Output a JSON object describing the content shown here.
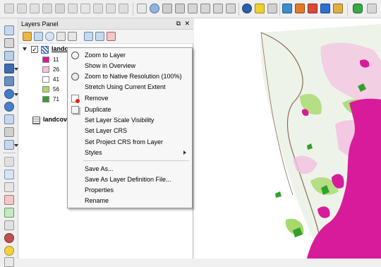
{
  "layers_panel": {
    "title": "Layers Panel",
    "float_glyph": "⧉",
    "close_glyph": "✕",
    "layers": [
      {
        "name": "landc",
        "checked": true,
        "expanded": true,
        "legend": [
          {
            "value": "11",
            "color": "#d81b9b"
          },
          {
            "value": "26",
            "color": "#f3bfe0"
          },
          {
            "value": "41",
            "color": "#ffffff"
          },
          {
            "value": "56",
            "color": "#a6d96a"
          },
          {
            "value": "71",
            "color": "#33a02c"
          }
        ]
      },
      {
        "name": "landcove",
        "checked": false,
        "expanded": false
      }
    ]
  },
  "context_menu": {
    "items": [
      {
        "label": "Zoom to Layer",
        "icon": "zoom-to-layer-icon"
      },
      {
        "label": "Show in Overview",
        "icon": ""
      },
      {
        "label": "Zoom to Native Resolution (100%)",
        "icon": "zoom-native-icon"
      },
      {
        "label": "Stretch Using Current Extent",
        "icon": ""
      },
      {
        "label": "Remove",
        "icon": "remove-layer-icon"
      },
      {
        "label": "Duplicate",
        "icon": "duplicate-layer-icon"
      },
      {
        "label": "Set Layer Scale Visibility",
        "icon": ""
      },
      {
        "label": "Set Layer CRS",
        "icon": ""
      },
      {
        "label": "Set Project CRS from Layer",
        "icon": ""
      },
      {
        "label": "Styles",
        "icon": "",
        "submenu": true
      },
      {
        "label": "Save As...",
        "icon": ""
      },
      {
        "label": "Save As Layer Definition File...",
        "icon": ""
      },
      {
        "label": "Properties",
        "icon": ""
      },
      {
        "label": "Rename",
        "icon": ""
      }
    ]
  },
  "colors": {
    "class_11": "#d81b9b",
    "class_26": "#f3bfe0",
    "class_56": "#a6d96a",
    "class_71": "#33a02c"
  }
}
